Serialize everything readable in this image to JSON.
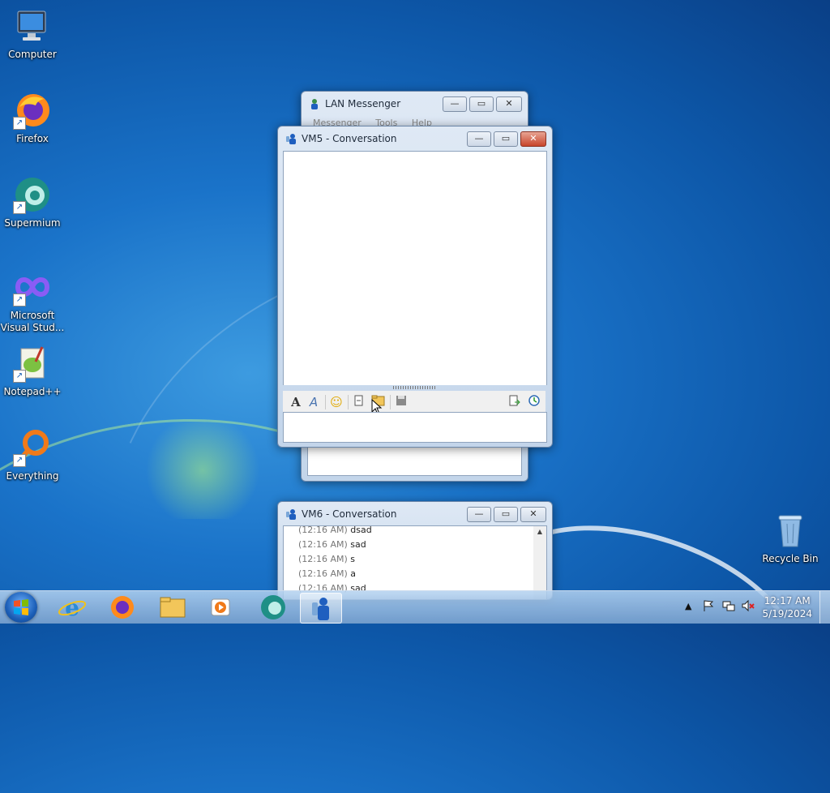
{
  "desktop": {
    "icons": [
      {
        "label": "Computer"
      },
      {
        "label": "Firefox"
      },
      {
        "label": "Supermium"
      },
      {
        "label": "Microsoft Visual Stud..."
      },
      {
        "label": "Notepad++"
      },
      {
        "label": "Everything"
      },
      {
        "label": "Recycle Bin"
      }
    ]
  },
  "lan_messenger": {
    "title": "LAN Messenger",
    "menu": [
      "Messenger",
      "Tools",
      "Help"
    ]
  },
  "vm5": {
    "title": "VM5 - Conversation",
    "toolbar": [
      "font-icon",
      "font-color-icon",
      "smiley-icon",
      "send-file-icon",
      "send-folder-icon",
      "save-icon",
      "transfers-icon",
      "history-icon"
    ]
  },
  "vm6": {
    "title": "VM6 - Conversation",
    "messages": [
      {
        "time": "(12:16 AM)",
        "text": "dsad"
      },
      {
        "time": "(12:16 AM)",
        "text": "sad"
      },
      {
        "time": "(12:16 AM)",
        "text": "s"
      },
      {
        "time": "(12:16 AM)",
        "text": "a"
      },
      {
        "time": "(12:16 AM)",
        "text": "sad"
      }
    ]
  },
  "taskbar": {
    "time": "12:17 AM",
    "date": "5/19/2024"
  },
  "colors": {
    "desktop_blue": "#1a73c9",
    "close_red": "#c7452b"
  }
}
